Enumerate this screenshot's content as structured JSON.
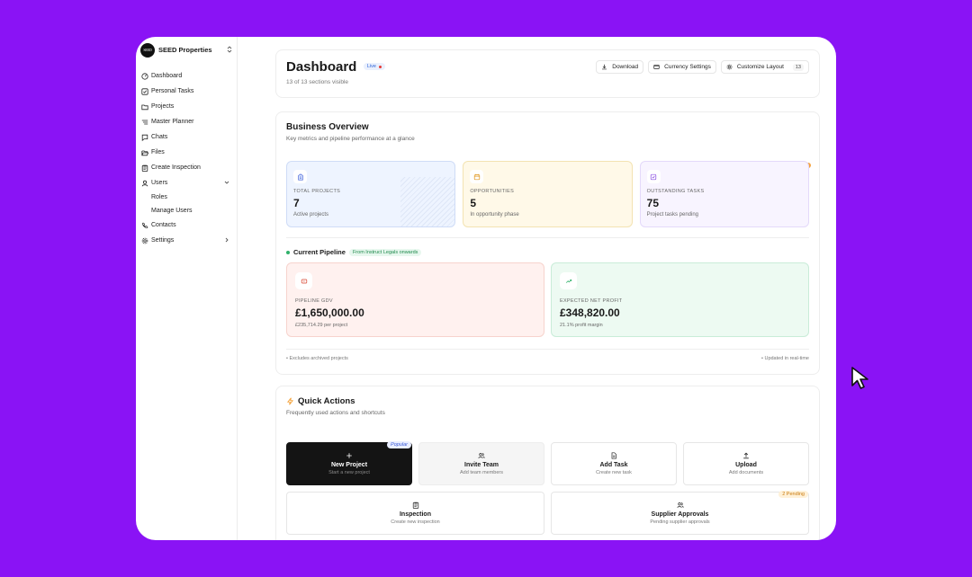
{
  "brand": {
    "logo_text": "SEED",
    "name": "SEED Properties",
    "toggle": "⌃⌄"
  },
  "sidebar": {
    "items": [
      {
        "label": "Dashboard",
        "icon": "dashboard-icon"
      },
      {
        "label": "Personal Tasks",
        "icon": "check-square-icon"
      },
      {
        "label": "Projects",
        "icon": "folder-icon"
      },
      {
        "label": "Master Planner",
        "icon": "list-icon"
      },
      {
        "label": "Chats",
        "icon": "chat-icon"
      },
      {
        "label": "Files",
        "icon": "folder-open-icon"
      },
      {
        "label": "Create Inspection",
        "icon": "clipboard-icon"
      },
      {
        "label": "Users",
        "icon": "user-icon"
      },
      {
        "label": "Contacts",
        "icon": "phone-icon"
      },
      {
        "label": "Settings",
        "icon": "gear-icon"
      }
    ],
    "users_sub": [
      "Roles",
      "Manage Users"
    ]
  },
  "header": {
    "title": "Dashboard",
    "live_badge": "Live",
    "sections_visible": "13 of 13 sections visible",
    "download": "Download",
    "currency_settings": "Currency Settings",
    "customize_layout": "Customize Layout",
    "layout_count": "13"
  },
  "overview": {
    "title": "Business Overview",
    "subtitle": "Key metrics and pipeline performance at a glance",
    "stats": [
      {
        "label": "TOTAL PROJECTS",
        "value": "7",
        "desc": "Active projects"
      },
      {
        "label": "OPPORTUNITIES",
        "value": "5",
        "desc": "In opportunity phase"
      },
      {
        "label": "OUTSTANDING TASKS",
        "value": "75",
        "desc": "Project tasks pending"
      }
    ],
    "pipeline_title": "Current Pipeline",
    "pipeline_badge": "From Instruct Legals onwards",
    "pipeline_cards": [
      {
        "label": "PIPELINE GDV",
        "value": "£1,650,000.00",
        "desc": "£235,714.29 per project"
      },
      {
        "label": "EXPECTED NET PROFIT",
        "value": "£348,820.00",
        "desc": "21.1% profit margin"
      }
    ],
    "footer_left": "• Excludes archived projects",
    "footer_right": "• Updated in real-time"
  },
  "quick": {
    "title": "Quick Actions",
    "subtitle": "Frequently used actions and shortcuts",
    "actions": [
      {
        "label": "New Project",
        "sub": "Start a new project",
        "tag": "Popular"
      },
      {
        "label": "Invite Team",
        "sub": "Add team members"
      },
      {
        "label": "Add Task",
        "sub": "Create new task"
      },
      {
        "label": "Upload",
        "sub": "Add documents"
      },
      {
        "label": "Inspection",
        "sub": "Create new inspection"
      },
      {
        "label": "Supplier Approvals",
        "sub": "Pending supplier approvals",
        "tag": "2 Pending"
      }
    ]
  },
  "colors": {
    "background": "#8a13f5",
    "accent_blue": "#2c62d8",
    "green": "#2fb16a"
  }
}
